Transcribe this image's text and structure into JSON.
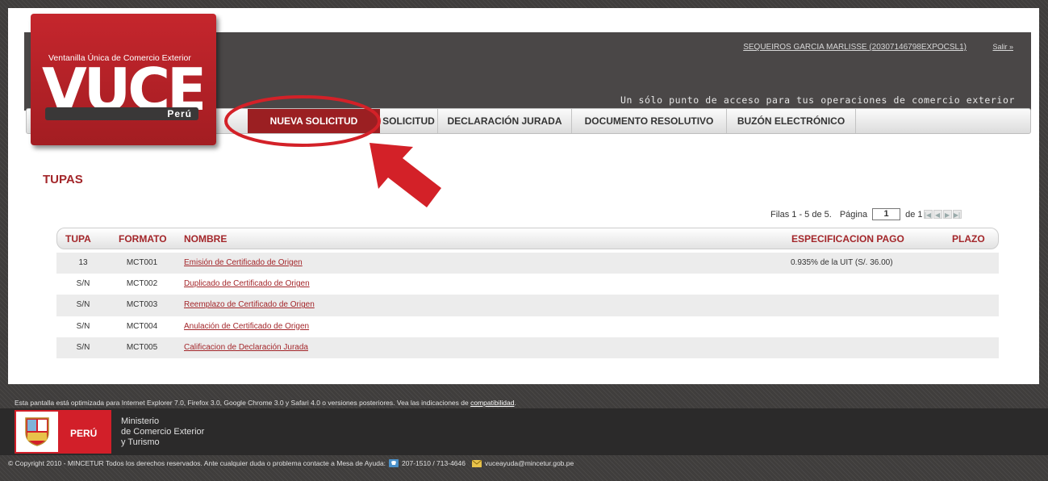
{
  "logo": {
    "subtitle": "Ventanilla Única de Comercio Exterior",
    "word": "VUCE",
    "country": "Perú"
  },
  "header": {
    "user": "SEQUEIROS GARCIA MARLISSE (20307146798EXPOCSL1)",
    "logout": "Salir »",
    "tagline": "Un sólo punto de acceso para tus operaciones de comercio exterior"
  },
  "nav": {
    "tabs": [
      {
        "label": "NUEVA SOLICITUD",
        "active": true
      },
      {
        "label": "SOLICITUD",
        "active": false
      },
      {
        "label": "DECLARACIÓN JURADA",
        "active": false
      },
      {
        "label": "DOCUMENTO RESOLUTIVO",
        "active": false
      },
      {
        "label": "BUZÓN ELECTRÓNICO",
        "active": false
      }
    ]
  },
  "section": {
    "title": "TUPAS"
  },
  "pagination": {
    "rows_label": "Filas 1 - 5 de 5.",
    "page_label": "Página",
    "page_value": "1",
    "of_label": "de 1"
  },
  "table": {
    "headers": [
      "TUPA",
      "FORMATO",
      "NOMBRE",
      "ESPECIFICACION PAGO",
      "PLAZO"
    ],
    "rows": [
      {
        "tupa": "13",
        "formato": "MCT001",
        "nombre": "Emisión de Certificado de Origen",
        "espec": "0.935% de la UIT (S/. 36.00)",
        "plazo": ""
      },
      {
        "tupa": "S/N",
        "formato": "MCT002",
        "nombre": "Duplicado de Certificado de Origen",
        "espec": "",
        "plazo": ""
      },
      {
        "tupa": "S/N",
        "formato": "MCT003",
        "nombre": "Reemplazo de Certificado de Origen",
        "espec": "",
        "plazo": ""
      },
      {
        "tupa": "S/N",
        "formato": "MCT004",
        "nombre": "Anulación de Certificado de Origen",
        "espec": "",
        "plazo": ""
      },
      {
        "tupa": "S/N",
        "formato": "MCT005",
        "nombre": "Calificacion de Declaración Jurada",
        "espec": "",
        "plazo": ""
      }
    ]
  },
  "footer": {
    "note": "Esta pantalla está optimizada para Internet Explorer 7.0, Firefox 3.0, Google Chrome 3.0 y Safari 4.0 o versiones posteriores. Vea las indicaciones de ",
    "compat_link": "compatibilidad",
    "note_end": ".",
    "country": "PERÚ",
    "ministry_line1": "Ministerio",
    "ministry_line2": "de Comercio Exterior",
    "ministry_line3": "y Turismo",
    "copyright": "© Copyright 2010 - MINCETUR Todos los derechos reservados. Ante cualquier duda o problema contacte a Mesa de Ayuda:",
    "phone": "207-1510 / 713-4646",
    "email": "vuceayuda@mincetur.gob.pe"
  },
  "colors": {
    "brand_red": "#a3262a",
    "active_tab": "#9b1f22",
    "annotation": "#d32128",
    "header_dark": "#4a4747"
  },
  "icons": [
    "phone-icon",
    "mail-icon",
    "first-page-icon",
    "prev-page-icon",
    "next-page-icon",
    "last-page-icon",
    "peru-crest-icon"
  ]
}
